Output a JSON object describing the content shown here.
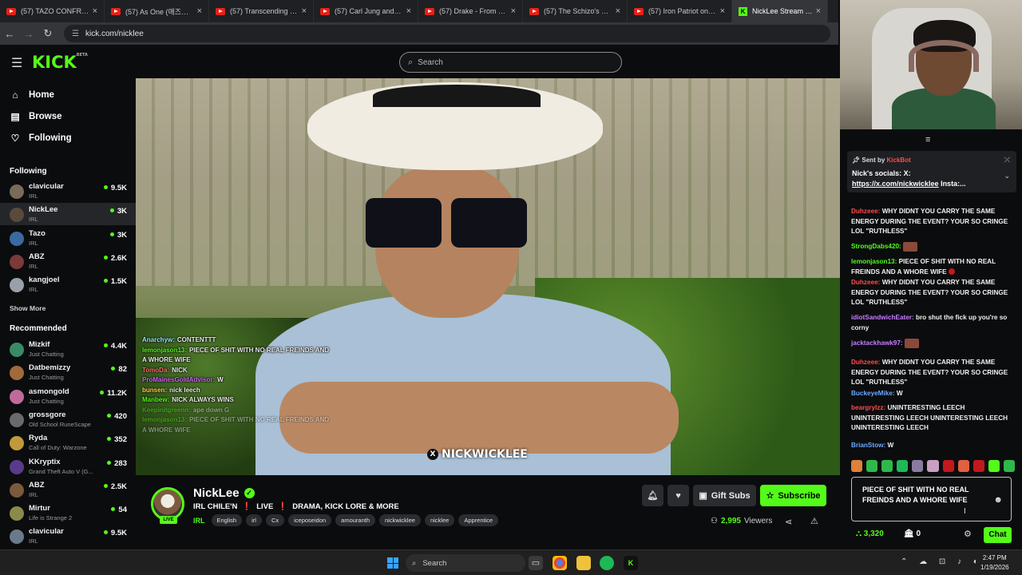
{
  "browser": {
    "tabs": [
      {
        "label": "(57) TAZO CONFRONTS"
      },
      {
        "label": "(57) As One (애즈원) - L"
      },
      {
        "label": "(57) Transcending Circu"
      },
      {
        "label": "(57) Carl Jung and the P"
      },
      {
        "label": "(57) Drake - From Time"
      },
      {
        "label": "(57) The Schizo's Journe"
      },
      {
        "label": "(57) Iron Patriot on Kill"
      },
      {
        "label": "NickLee Stream - W",
        "active": true
      }
    ],
    "url": "kick.com/nicklee"
  },
  "header": {
    "logo": "KICK",
    "logo_sup": "BETA",
    "search_placeholder": "Search"
  },
  "sidebar": {
    "nav": [
      {
        "label": "Home",
        "icon": "home-icon"
      },
      {
        "label": "Browse",
        "icon": "browse-icon"
      },
      {
        "label": "Following",
        "icon": "heart-icon"
      }
    ],
    "following_title": "Following",
    "following": [
      {
        "name": "clavicular",
        "category": "IRL",
        "viewers": "9.5K"
      },
      {
        "name": "NickLee",
        "category": "IRL",
        "viewers": "3K",
        "selected": true
      },
      {
        "name": "Tazo",
        "category": "IRL",
        "viewers": "3K"
      },
      {
        "name": "ABZ",
        "category": "IRL",
        "viewers": "2.6K"
      },
      {
        "name": "kangjoel",
        "category": "IRL",
        "viewers": "1.5K"
      }
    ],
    "show_more": "Show More",
    "recommended_title": "Recommended",
    "recommended": [
      {
        "name": "Mizkif",
        "category": "Just Chatting",
        "viewers": "4.4K"
      },
      {
        "name": "Datbemizzy",
        "category": "Just Chatting",
        "viewers": "82"
      },
      {
        "name": "asmongold",
        "category": "Just Chatting",
        "viewers": "11.2K"
      },
      {
        "name": "grossgore",
        "category": "Old School RuneScape",
        "viewers": "420"
      },
      {
        "name": "Ryda",
        "category": "Call of Duty: Warzone",
        "viewers": "352"
      },
      {
        "name": "KKryptix",
        "category": "Grand Theft Auto V (G...",
        "viewers": "283"
      },
      {
        "name": "ABZ",
        "category": "IRL",
        "viewers": "2.5K"
      },
      {
        "name": "Mirtur",
        "category": "Life is Strange 2",
        "viewers": "54"
      },
      {
        "name": "clavicular",
        "category": "IRL",
        "viewers": "9.5K"
      }
    ]
  },
  "video": {
    "overlay_chat": [
      {
        "user": "Anarchyw:",
        "text": "CONTENTTT",
        "color": "#8fe3ff"
      },
      {
        "user": "lemonjason13:",
        "text": "PIECE OF SHIT WITH NO REAL FREINDS AND A WHORE WIFE",
        "color": "#53fc18"
      },
      {
        "user": "TomoDa:",
        "text": "NICK",
        "color": "#ff6b6b"
      },
      {
        "user": "ProMainesGoldAdvisor:",
        "text": "W",
        "color": "#d35fff"
      },
      {
        "user": "bunsen:",
        "text": "nick leech",
        "color": "#ffd24a"
      },
      {
        "user": "Manbew:",
        "text": "NICK ALWAYS WINS",
        "color": "#53fc18"
      },
      {
        "user": "Keepinitgreenn:",
        "text": "ape down G",
        "color": "#53fc18"
      },
      {
        "user": "lemonjason13:",
        "text": "PIECE OF SHIT WITH NO REAL FREINDS AND A WHORE WIFE",
        "color": "#53fc18"
      }
    ],
    "watermark": "NICKWICKLEE",
    "watermark_icon": "X"
  },
  "stream": {
    "streamer": "NickLee",
    "live_badge": "LIVE",
    "title_parts": [
      "IRL CHILE'N",
      "LIVE",
      "DRAMA, KICK LORE & MORE"
    ],
    "title_sep": "❗",
    "category": "IRL",
    "tags": [
      "English",
      "irl",
      "Cx",
      "iceposeidon",
      "amouranth",
      "nickwicklee",
      "nicklee",
      "Apprentice"
    ],
    "gift_subs": "Gift Subs",
    "subscribe": "Subscribe",
    "viewers": "2,995",
    "viewers_label": "Viewers"
  },
  "chat": {
    "pinned_sent_by": "Sent by",
    "pinned_sender": "KickBot",
    "pinned_text": "Nick's socials: X:",
    "pinned_link": "https://x.com/nickwicklee",
    "pinned_tail": "Insta:...",
    "messages": [
      {
        "user": "Duhzeee:",
        "text": "WHY DIDNT YOU CARRY THE SAME ENERGY DURING THE EVENT? YOUR SO CRINGE LOL \"RUTHLESS\"",
        "color": "#ff4b4b"
      },
      {
        "user": "StrongDabs420:",
        "text": "",
        "color": "#53fc18"
      },
      {
        "user": "lemonjason13:",
        "text": "PIECE OF SHIT WITH NO REAL FREINDS AND A WHORE WIFE",
        "color": "#53fc18"
      },
      {
        "user": "Duhzeee:",
        "text": "WHY DIDNT YOU CARRY THE SAME ENERGY DURING THE EVENT? YOUR SO CRINGE LOL \"RUTHLESS\"",
        "color": "#ff4b4b"
      },
      {
        "user": "idiotSandwichEater:",
        "text": "bro shut the fick up you're so corny",
        "color": "#c77dff"
      },
      {
        "user": "jacktackhawk97:",
        "text": "",
        "color": "#c77dff"
      },
      {
        "user": "Duhzeee:",
        "text": "WHY DIDNT YOU CARRY THE SAME ENERGY DURING THE EVENT? YOUR SO CRINGE LOL \"RUTHLESS\"",
        "color": "#ff4b4b"
      },
      {
        "user": "BuckeyeMike:",
        "text": "W",
        "color": "#6aa8ff"
      },
      {
        "user": "beargrylzz:",
        "text": "UNINTERESTING LEECH UNINTERESTING LEECH UNINTERESTING LEECH UNINTERESTING LEECH",
        "color": "#ff4b4b"
      },
      {
        "user": "BrianStow:",
        "text": "W",
        "color": "#6aa8ff"
      }
    ],
    "input_text": "PIECE OF SHIT WITH NO REAL FREINDS AND A WHORE WIFE",
    "points": "3,320",
    "bank": "0",
    "send": "Chat"
  },
  "taskbar": {
    "search": "Search",
    "time": "2:47 PM",
    "date": "1/19/2026"
  },
  "colors": {
    "accent": "#53fc18",
    "background": "#0b0c0e"
  }
}
